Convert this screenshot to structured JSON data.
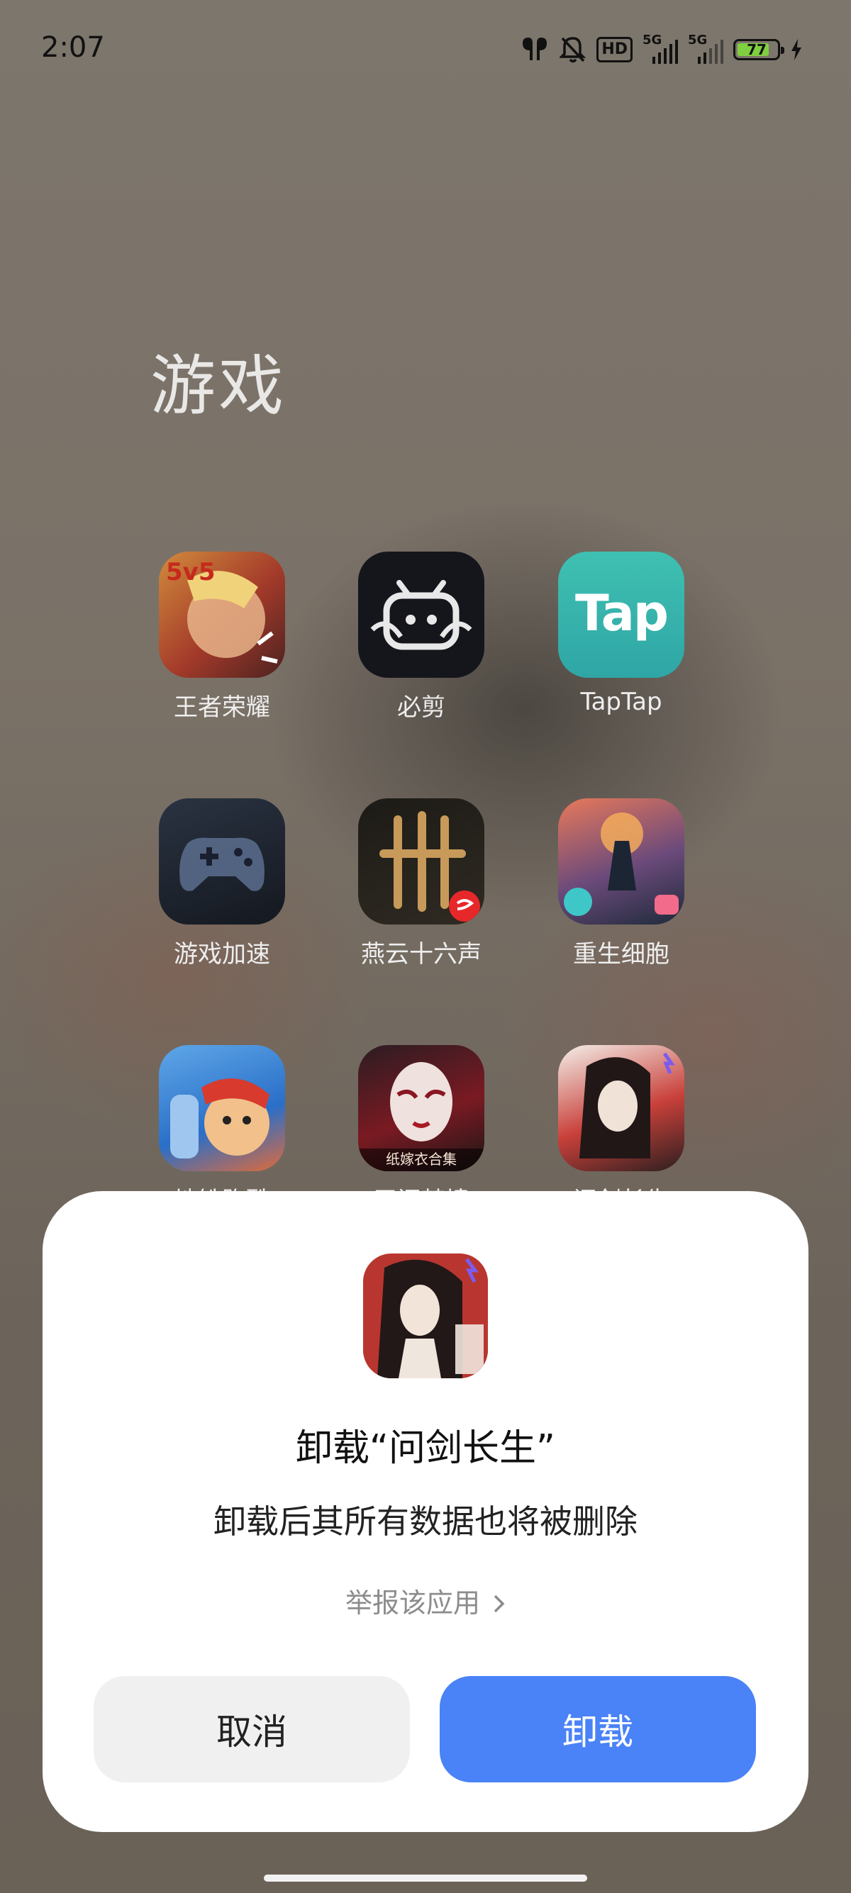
{
  "status_bar": {
    "time": "2:07",
    "hd_label": "HD",
    "network1": "5G",
    "network2": "5G",
    "battery_percent": "77",
    "icons": [
      "earbuds-icon",
      "mute-bell-icon",
      "hd-icon",
      "signal-icon",
      "signal-icon",
      "battery-icon",
      "charging-icon"
    ]
  },
  "folder": {
    "title": "游戏",
    "apps": [
      {
        "label": "王者荣耀",
        "icon": "honor-of-kings-icon"
      },
      {
        "label": "必剪",
        "icon": "bijian-icon"
      },
      {
        "label": "TapTap",
        "icon": "taptap-icon",
        "icon_text": "Tap"
      },
      {
        "label": "游戏加速",
        "icon": "gamepad-icon"
      },
      {
        "label": "燕云十六声",
        "icon": "yanyun-icon"
      },
      {
        "label": "重生细胞",
        "icon": "dead-cells-icon"
      },
      {
        "label": "地铁跑酷",
        "icon": "subway-surfers-icon"
      },
      {
        "label": "无间梦境",
        "icon": "opera-mask-icon",
        "icon_text": "纸嫁衣合集"
      },
      {
        "label": "问剑长生",
        "icon": "wenjian-icon"
      }
    ]
  },
  "dialog": {
    "title": "卸载“问剑长生”",
    "description": "卸载后其所有数据也将被删除",
    "report_link": "举报该应用",
    "cancel_label": "取消",
    "confirm_label": "卸载",
    "confirm_color": "#4a82f7"
  }
}
